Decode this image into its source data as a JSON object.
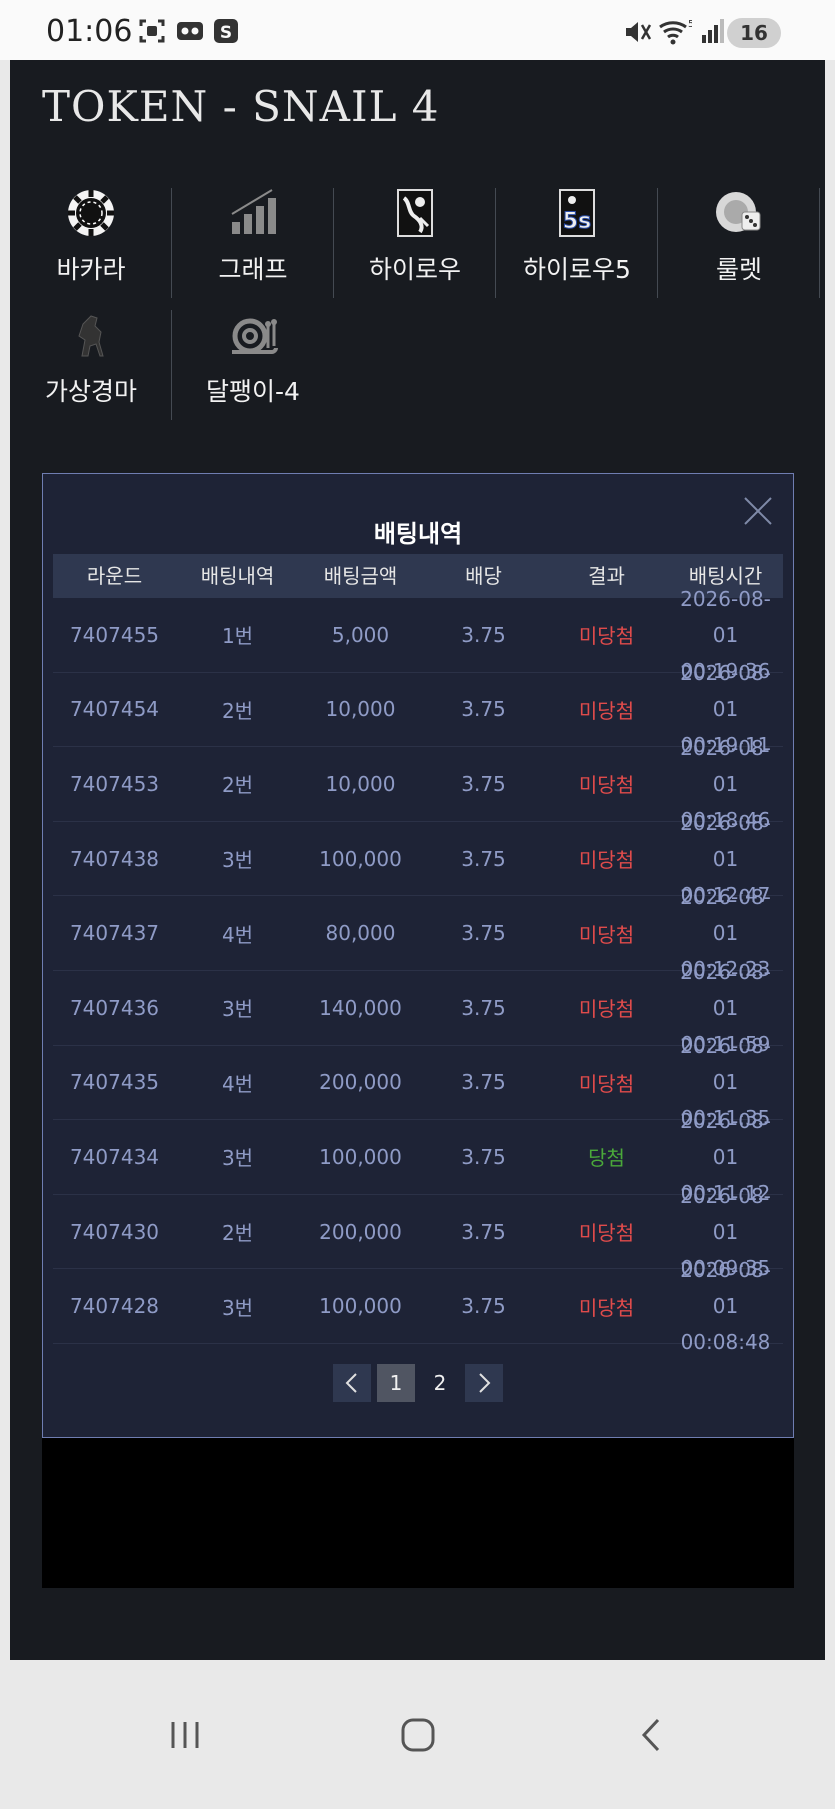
{
  "status": {
    "time": "01:06",
    "battery": "16",
    "signal_label": "5"
  },
  "app": {
    "title": "TOKEN - SNAIL 4"
  },
  "games": [
    {
      "label": "바카라",
      "icon": "poker-chip-icon"
    },
    {
      "label": "그래프",
      "icon": "bar-graph-icon"
    },
    {
      "label": "하이로우",
      "icon": "card-hilo-icon"
    },
    {
      "label": "하이로우5",
      "icon": "card-hilo5-icon"
    },
    {
      "label": "룰렛",
      "icon": "dice-icon"
    },
    {
      "label": "가상경마",
      "icon": "horse-icon"
    },
    {
      "label": "달팽이-4",
      "icon": "snail-icon"
    }
  ],
  "modal": {
    "title": "배팅내역",
    "headers": [
      "라운드",
      "배팅내역",
      "배팅금액",
      "배당",
      "결과",
      "배팅시간"
    ],
    "rows": [
      {
        "round": "7407455",
        "pick": "1번",
        "amount": "5,000",
        "odds": "3.75",
        "result": "미당첨",
        "date": "2026-08-01",
        "time": "00:19:36"
      },
      {
        "round": "7407454",
        "pick": "2번",
        "amount": "10,000",
        "odds": "3.75",
        "result": "미당첨",
        "date": "2026-08-01",
        "time": "00:19:11"
      },
      {
        "round": "7407453",
        "pick": "2번",
        "amount": "10,000",
        "odds": "3.75",
        "result": "미당첨",
        "date": "2026-08-01",
        "time": "00:18:46"
      },
      {
        "round": "7407438",
        "pick": "3번",
        "amount": "100,000",
        "odds": "3.75",
        "result": "미당첨",
        "date": "2026-08-01",
        "time": "00:12:47"
      },
      {
        "round": "7407437",
        "pick": "4번",
        "amount": "80,000",
        "odds": "3.75",
        "result": "미당첨",
        "date": "2026-08-01",
        "time": "00:12:23"
      },
      {
        "round": "7407436",
        "pick": "3번",
        "amount": "140,000",
        "odds": "3.75",
        "result": "미당첨",
        "date": "2026-08-01",
        "time": "00:11:59"
      },
      {
        "round": "7407435",
        "pick": "4번",
        "amount": "200,000",
        "odds": "3.75",
        "result": "미당첨",
        "date": "2026-08-01",
        "time": "00:11:35"
      },
      {
        "round": "7407434",
        "pick": "3번",
        "amount": "100,000",
        "odds": "3.75",
        "result": "당첨",
        "date": "2026-08-01",
        "time": "00:11:12"
      },
      {
        "round": "7407430",
        "pick": "2번",
        "amount": "200,000",
        "odds": "3.75",
        "result": "미당첨",
        "date": "2026-08-01",
        "time": "00:09:35"
      },
      {
        "round": "7407428",
        "pick": "3번",
        "amount": "100,000",
        "odds": "3.75",
        "result": "미당첨",
        "date": "2026-08-01",
        "time": "00:08:48"
      }
    ],
    "pages": [
      "1",
      "2"
    ],
    "current_page": "1"
  },
  "colors": {
    "lose": "#e04b4b",
    "win": "#4aa83a",
    "modal_border": "#6f7db1"
  }
}
